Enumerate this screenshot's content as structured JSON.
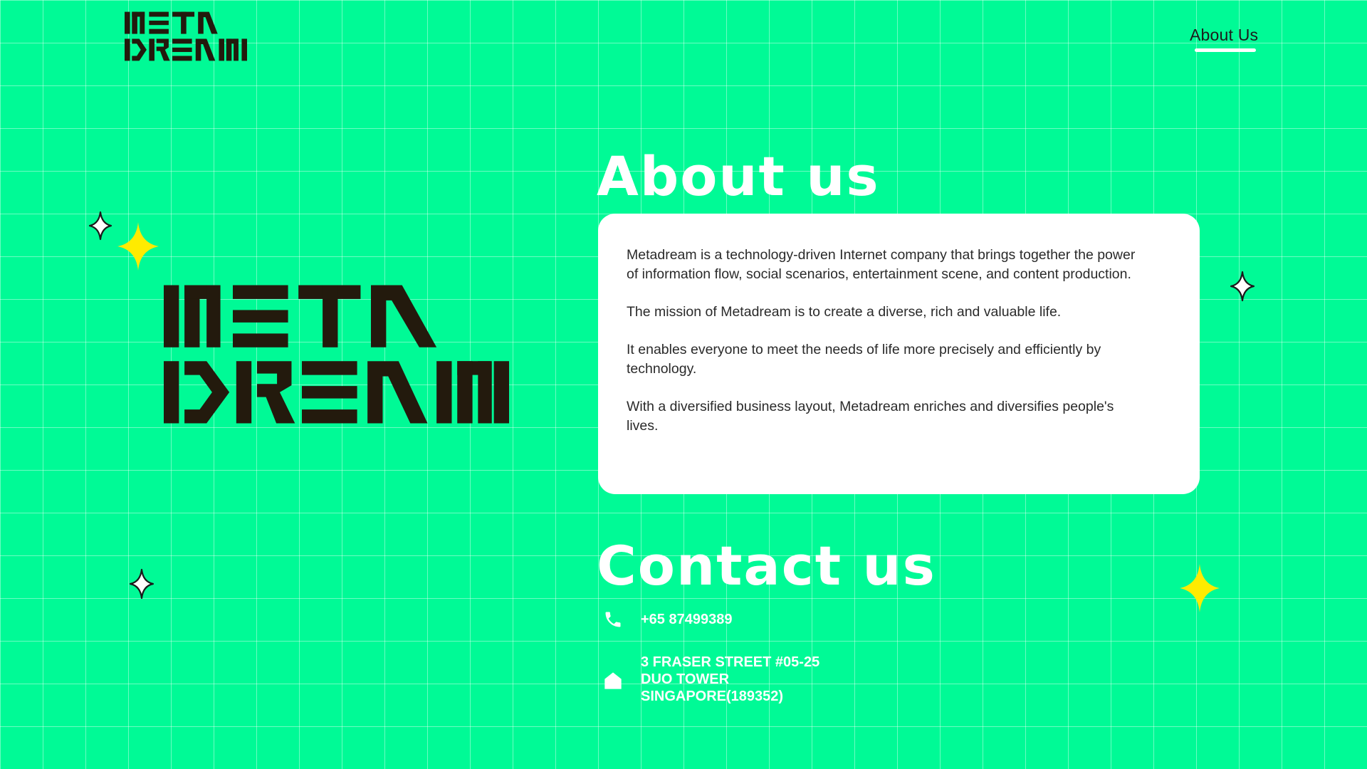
{
  "header": {
    "logo_icon": "metadream-logo",
    "nav": {
      "about_label": "About Us"
    }
  },
  "hero": {
    "logo_icon": "metadream-logo-large"
  },
  "about": {
    "heading": "About us",
    "paragraphs": [
      "Metadream is a technology-driven Internet company that brings together the power of information flow, social scenarios, entertainment scene, and content production.",
      "The mission of Metadream is to create a diverse, rich and valuable life.",
      "It enables everyone to meet the needs of life more precisely and efficiently by technology.",
      "With a diversified business layout, Metadream enriches and diversifies people's lives."
    ]
  },
  "contact": {
    "heading": "Contact us",
    "phone": "+65 87499389",
    "phone_icon": "phone-icon",
    "address_icon": "home-icon",
    "address_lines": [
      "3 FRASER STREET #05-25",
      "DUO TOWER",
      "SINGAPORE(189352)"
    ]
  },
  "colors": {
    "background": "#00fa96",
    "grid_line": "#ffffff",
    "logo": "#231a0d",
    "sparkle_yellow": "#ffeb00",
    "heading": "#ffffff"
  }
}
